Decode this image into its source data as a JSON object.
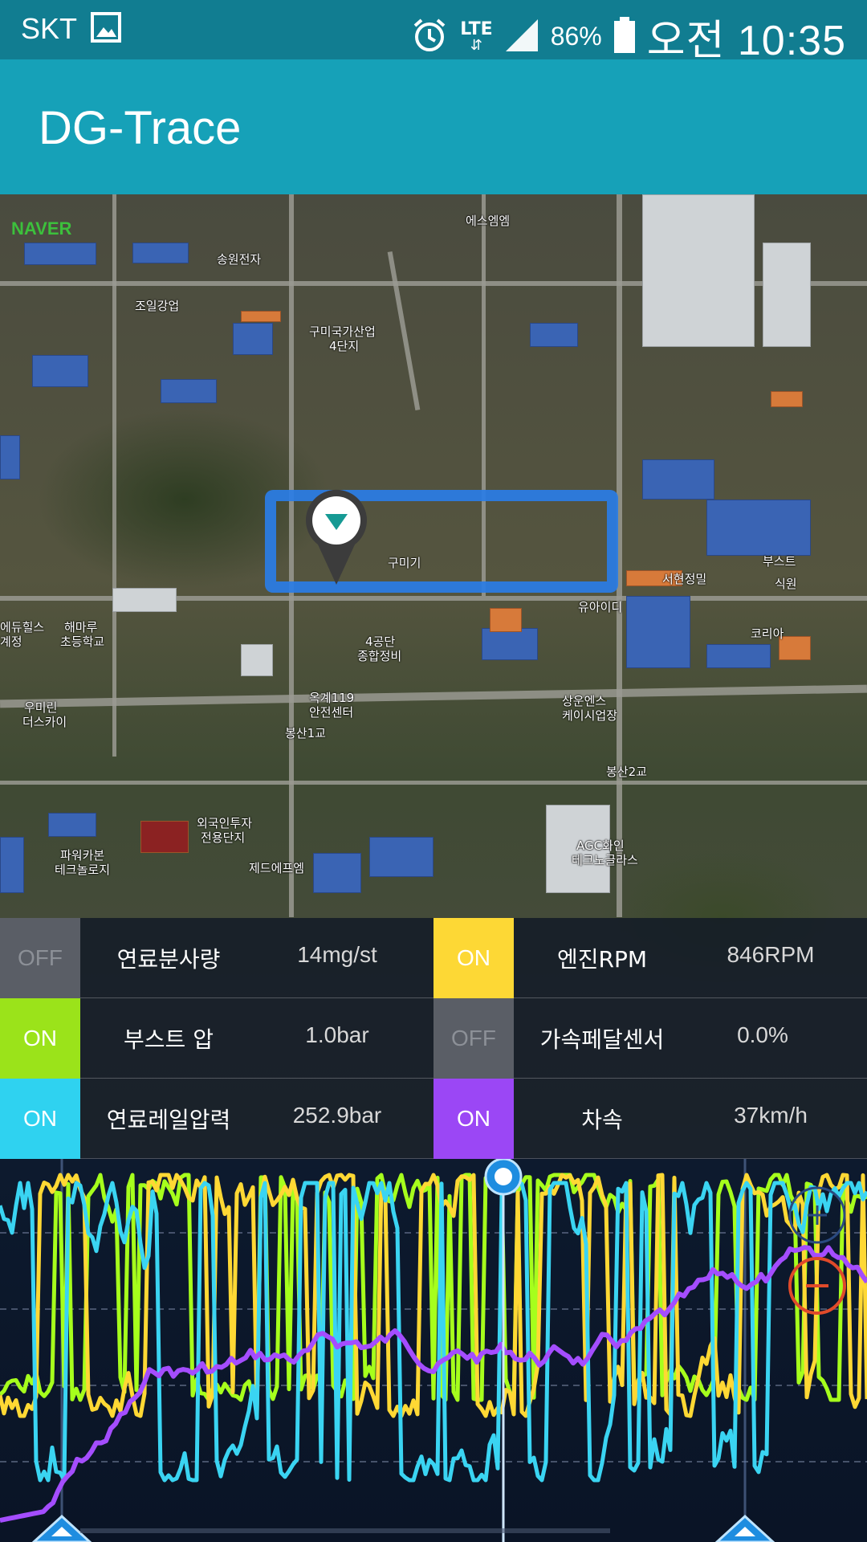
{
  "status_bar": {
    "carrier": "SKT",
    "network": "LTE",
    "battery": "86%",
    "time": "오전 10:35",
    "icons": [
      "gallery-icon",
      "alarm-icon",
      "lte-icon",
      "signal-icon",
      "battery-icon"
    ]
  },
  "app_bar": {
    "title": "DG-Trace"
  },
  "map": {
    "provider": "NAVER",
    "labels": [
      {
        "text": "송원전자"
      },
      {
        "text": "에스엠엠"
      },
      {
        "text": "조일강업"
      },
      {
        "text": "구미국가산업"
      },
      {
        "text": "4단지"
      },
      {
        "text": "구미기"
      },
      {
        "text": "유아이디"
      },
      {
        "text": "서현정밀"
      },
      {
        "text": "식원"
      },
      {
        "text": "해마루"
      },
      {
        "text": "초등학교"
      },
      {
        "text": "4공단"
      },
      {
        "text": "종합정비"
      },
      {
        "text": "옥계119"
      },
      {
        "text": "안전센터"
      },
      {
        "text": "봉산1교"
      },
      {
        "text": "봉산2교"
      },
      {
        "text": "외국인투자"
      },
      {
        "text": "전용단지"
      },
      {
        "text": "AGC화인"
      },
      {
        "text": "테크노글라스"
      },
      {
        "text": "파워카본"
      },
      {
        "text": "테크놀로지"
      },
      {
        "text": "우미린"
      },
      {
        "text": "더스카이"
      },
      {
        "text": "에듀힐스"
      },
      {
        "text": "계정"
      },
      {
        "text": "부스트"
      },
      {
        "text": "상운엔스"
      },
      {
        "text": "케이시업장"
      },
      {
        "text": "제드에프엠"
      },
      {
        "text": "코리아"
      }
    ]
  },
  "sensors": [
    {
      "state": "OFF",
      "name": "연료분사량",
      "value": "14mg/st",
      "color": "#5a5e66"
    },
    {
      "state": "ON",
      "name": "엔진RPM",
      "value": "846RPM",
      "color": "#fdd835"
    },
    {
      "state": "ON",
      "name": "부스트 압",
      "value": "1.0bar",
      "color": "#9be31a"
    },
    {
      "state": "OFF",
      "name": "가속페달센서",
      "value": "0.0%",
      "color": "#5a5e66"
    },
    {
      "state": "ON",
      "name": "연료레일압력",
      "value": "252.9bar",
      "color": "#2fd2f0"
    },
    {
      "state": "ON",
      "name": "차속",
      "value": "37km/h",
      "color": "#9b47f5"
    }
  ],
  "graph": {
    "series_colors": {
      "rpm": "#ffd834",
      "boost": "#a6ff1c",
      "rail": "#3ad4f2",
      "speed": "#a44dff"
    },
    "controls": [
      "zoom-in-button",
      "zoom-out-button",
      "playhead-handle",
      "range-start-handle",
      "range-end-handle"
    ]
  }
}
